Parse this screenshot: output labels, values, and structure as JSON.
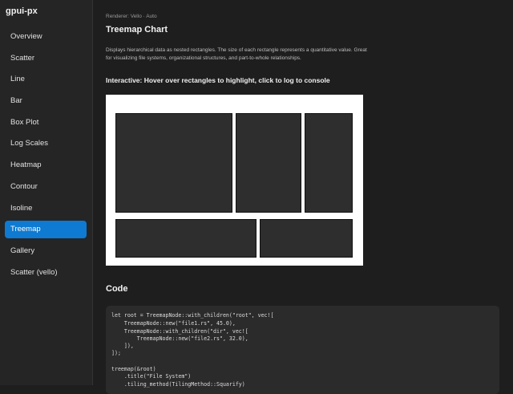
{
  "app": {
    "title": "gpui-px"
  },
  "sidebar": {
    "items": [
      {
        "label": "Overview",
        "active": false
      },
      {
        "label": "Scatter",
        "active": false
      },
      {
        "label": "Line",
        "active": false
      },
      {
        "label": "Bar",
        "active": false
      },
      {
        "label": "Box Plot",
        "active": false
      },
      {
        "label": "Log Scales",
        "active": false
      },
      {
        "label": "Heatmap",
        "active": false
      },
      {
        "label": "Contour",
        "active": false
      },
      {
        "label": "Isoline",
        "active": false
      },
      {
        "label": "Treemap",
        "active": true
      },
      {
        "label": "Gallery",
        "active": false
      },
      {
        "label": "Scatter (vello)",
        "active": false
      }
    ]
  },
  "main": {
    "renderer": "Renderer: Vello · Auto",
    "title": "Treemap Chart",
    "description": "Displays hierarchical data as nested rectangles. The size of each rectangle represents a quantitative value. Great for visualizing file systems, organizational structures, and part-to-whole relationships.",
    "interactive_label": "Interactive: Hover over rectangles to highlight, click to log to console",
    "code_heading": "Code",
    "code_lines": [
      "let root = TreemapNode::with_children(\"root\", vec![",
      "    TreemapNode::new(\"file1.rs\", 45.0),",
      "    TreemapNode::with_children(\"dir\", vec![",
      "        TreemapNode::new(\"file2.rs\", 32.0),",
      "    ]),",
      "]);",
      "",
      "treemap(&root)",
      "    .title(\"File System\")",
      "    .tiling_method(TilingMethod::Squarify)"
    ]
  },
  "colors": {
    "accent": "#0e7ad1",
    "background": "#1e1e1e",
    "sidebar": "#252526",
    "tile": "#2e2e2e",
    "panel": "#ffffff"
  }
}
